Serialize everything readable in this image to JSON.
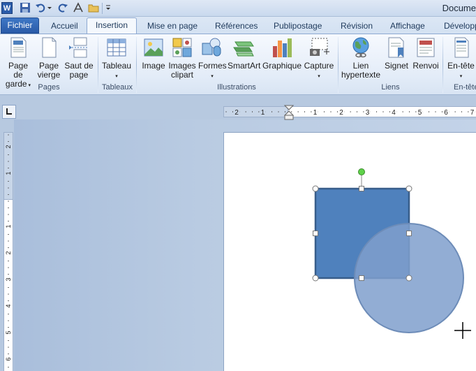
{
  "app": {
    "logo_letter": "W",
    "title": "Docume"
  },
  "tabs": [
    {
      "label": "Fichier"
    },
    {
      "label": "Accueil"
    },
    {
      "label": "Insertion"
    },
    {
      "label": "Mise en page"
    },
    {
      "label": "Références"
    },
    {
      "label": "Publipostage"
    },
    {
      "label": "Révision"
    },
    {
      "label": "Affichage"
    },
    {
      "label": "Développ"
    }
  ],
  "ribbon": {
    "groups": {
      "pages": "Pages",
      "tableaux": "Tableaux",
      "illustrations": "Illustrations",
      "liens": "Liens",
      "entete": "En-tête"
    },
    "buttons": {
      "page_de_garde_1": "Page de",
      "page_de_garde_2": "garde",
      "page_vierge_1": "Page",
      "page_vierge_2": "vierge",
      "saut_1": "Saut de",
      "saut_2": "page",
      "tableau": "Tableau",
      "image": "Image",
      "images_clipart_1": "Images",
      "images_clipart_2": "clipart",
      "formes": "Formes",
      "smartart": "SmartArt",
      "graphique": "Graphique",
      "capture": "Capture",
      "lien_1": "Lien",
      "lien_2": "hypertexte",
      "signet": "Signet",
      "renvoi": "Renvoi",
      "entete": "En-tête"
    }
  },
  "rulers": {
    "horizontal_labels": [
      "2",
      "1",
      "1",
      "2",
      "3",
      "4",
      "5",
      "6",
      "7"
    ],
    "vertical_labels": [
      "2",
      "1",
      "1",
      "2",
      "3",
      "4",
      "5",
      "6"
    ]
  },
  "colors": {
    "rectangle_fill": "#4f81bd",
    "rectangle_stroke": "#385d8a",
    "circle_fill": "#7f9fcc",
    "rotation_handle": "#5fd24a"
  }
}
